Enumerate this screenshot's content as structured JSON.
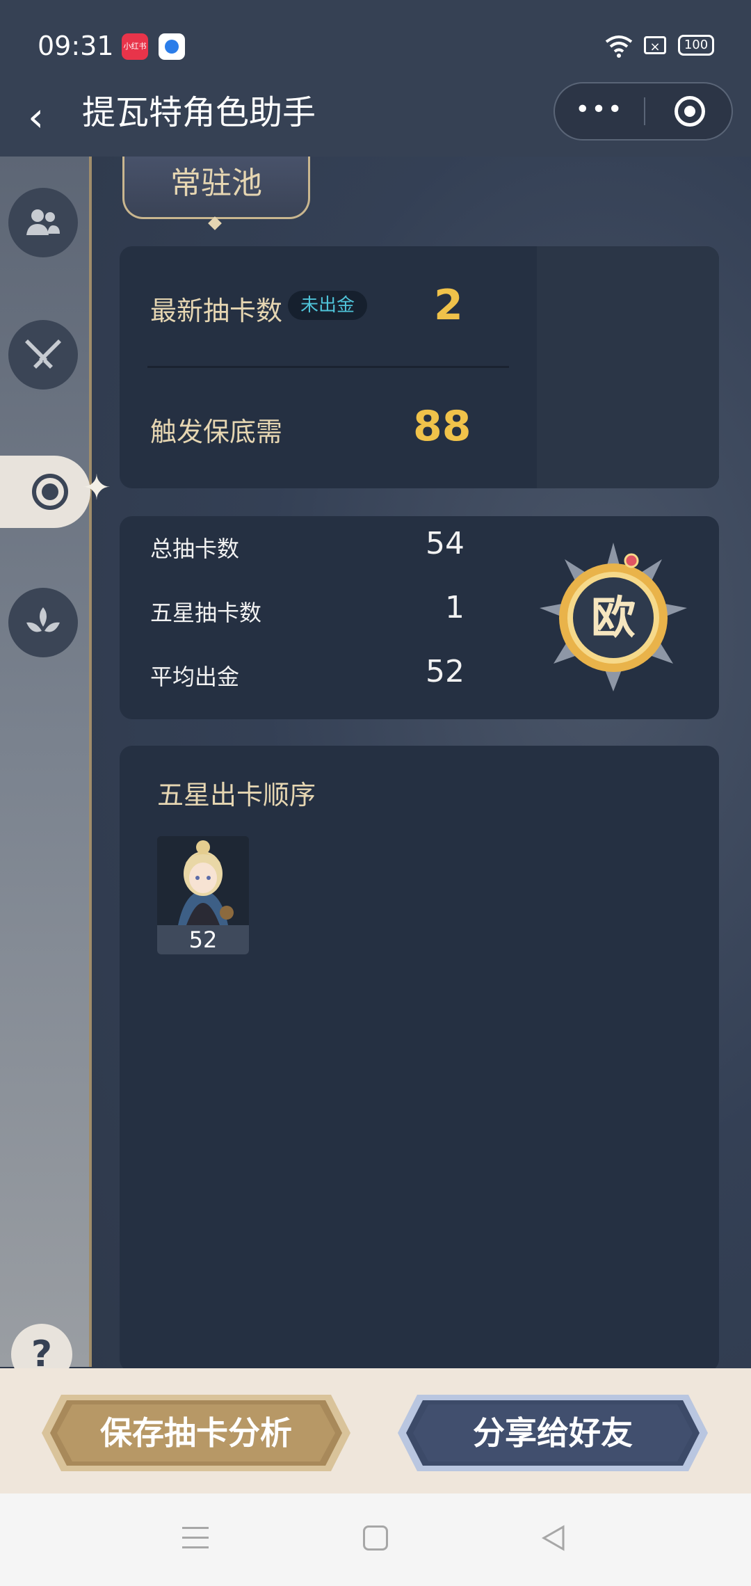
{
  "status_bar": {
    "time": "09:31",
    "app1_label": "小红书",
    "battery": "100"
  },
  "nav": {
    "title": "提瓦特角色助手",
    "more": "•••"
  },
  "banner": {
    "label": "常驻池"
  },
  "summary": {
    "latest_label": "最新抽卡数",
    "latest_tag": "未出金",
    "latest_value": "2",
    "pity_label": "触发保底需",
    "pity_value": "88"
  },
  "stats": {
    "total_label": "总抽卡数",
    "total_value": "54",
    "five_star_label": "五星抽卡数",
    "five_star_value": "1",
    "avg_label": "平均出金",
    "avg_value": "52",
    "badge": "欧"
  },
  "order": {
    "title": "五星出卡顺序",
    "items": [
      {
        "count": "52"
      }
    ]
  },
  "help": "?",
  "actions": {
    "save": "保存抽卡分析",
    "share": "分享给好友"
  },
  "colors": {
    "accent_gold": "#f0c24a",
    "tag_cyan": "#4fc3d8",
    "label_beige": "#e6d6b2"
  }
}
